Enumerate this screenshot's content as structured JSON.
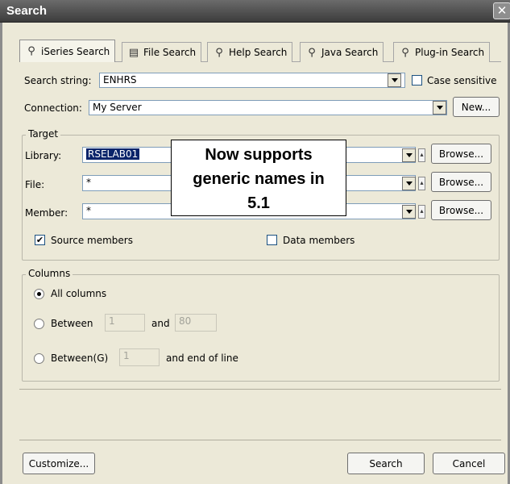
{
  "window": {
    "title": "Search",
    "close_glyph": "✕"
  },
  "tabs": [
    {
      "label": "iSeries Search",
      "icon": "iseries-search-icon",
      "glyph": "⚲"
    },
    {
      "label": "File Search",
      "icon": "file-search-icon",
      "glyph": "▤"
    },
    {
      "label": "Help Search",
      "icon": "help-search-icon",
      "glyph": "⚲"
    },
    {
      "label": "Java Search",
      "icon": "java-search-icon",
      "glyph": "⚲"
    },
    {
      "label": "Plug-in Search",
      "icon": "plugin-search-icon",
      "glyph": "⚲"
    }
  ],
  "search_string": {
    "label": "Search string:",
    "value": "ENHRS"
  },
  "case_sensitive": {
    "label": "Case sensitive",
    "checked": false
  },
  "connection": {
    "label": "Connection:",
    "value": "My Server",
    "new_button": "New..."
  },
  "target": {
    "legend": "Target",
    "library": {
      "label": "Library:",
      "value": "RSELAB01",
      "browse": "Browse..."
    },
    "file": {
      "label": "File:",
      "value": "*",
      "browse": "Browse..."
    },
    "member": {
      "label": "Member:",
      "value": "*",
      "browse": "Browse..."
    },
    "source_members": {
      "label": "Source members",
      "checked": true,
      "mark": "✔"
    },
    "data_members": {
      "label": "Data members",
      "checked": false
    }
  },
  "columns": {
    "legend": "Columns",
    "all_columns": {
      "label": "All columns",
      "selected": true
    },
    "between": {
      "label": "Between",
      "from": "1",
      "and_label": "and",
      "to": "80",
      "selected": false
    },
    "between_g": {
      "label": "Between(G)",
      "from": "1",
      "suffix": "and end of line",
      "selected": false
    }
  },
  "callout": {
    "line1": "Now supports",
    "line2": "generic names in",
    "line3": "5.1"
  },
  "footer": {
    "customize": "Customize...",
    "search": "Search",
    "cancel": "Cancel"
  }
}
